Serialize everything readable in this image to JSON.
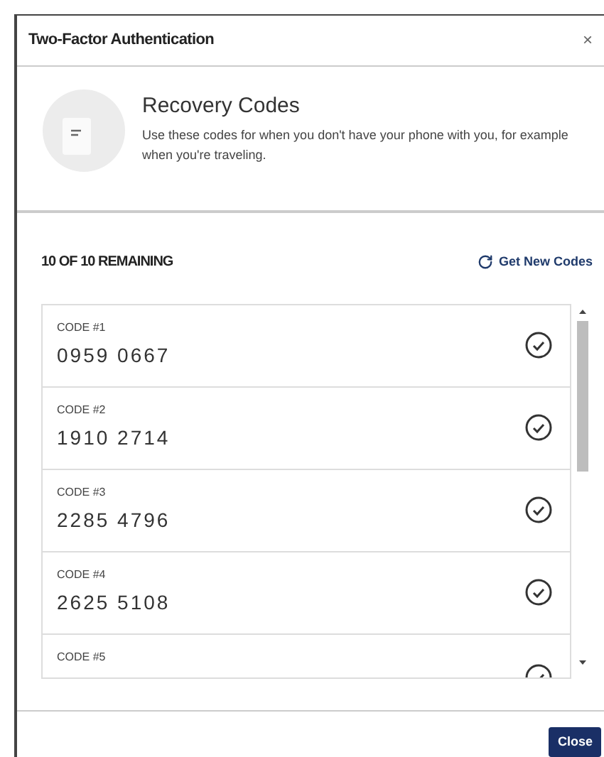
{
  "dialog": {
    "title": "Two-Factor Authentication",
    "close_glyph": "×"
  },
  "intro": {
    "title": "Recovery Codes",
    "description": "Use these codes for when you don't have your phone with you, for example when you're traveling."
  },
  "remaining": "10 OF 10 REMAINING",
  "get_new_codes": "Get New Codes",
  "codes": [
    {
      "label": "CODE #1",
      "value": "0959 0667"
    },
    {
      "label": "CODE #2",
      "value": "1910 2714"
    },
    {
      "label": "CODE #3",
      "value": "2285 4796"
    },
    {
      "label": "CODE #4",
      "value": "2625 5108"
    },
    {
      "label": "CODE #5"
    }
  ],
  "footer": {
    "close": "Close"
  }
}
